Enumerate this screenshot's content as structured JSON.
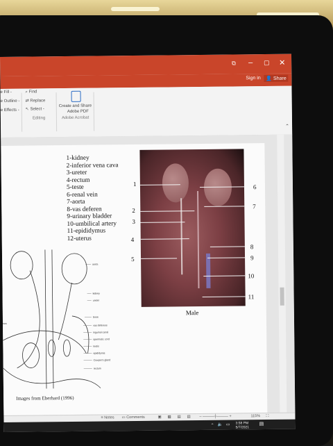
{
  "window": {
    "controls": [
      "⧉",
      "–",
      "▢",
      "✕"
    ],
    "sign_in": "Sign in",
    "share": "Share"
  },
  "ribbon": {
    "fill": "e Fill -",
    "outline": "e Outline -",
    "effects": "e Effects -",
    "find": "Find",
    "replace": "Replace",
    "select": "Select -",
    "editing_label": "Editing",
    "pdf_line1": "Create and Share",
    "pdf_line2": "Adobe PDF",
    "acrobat_label": "Adobe Acrobat"
  },
  "slide": {
    "legend": [
      "1-kidney",
      "2-inferior vena cava",
      "3-ureter",
      "4-rectum",
      "5-teste",
      "6-renal vein",
      "7-aorta",
      "8-vas deferen",
      "9-urinary bladder",
      "10-umbilical artery",
      "11-epididymus",
      "12-uterus"
    ],
    "photo_numbers_left": [
      "1",
      "2",
      "3",
      "4",
      "5"
    ],
    "photo_numbers_right": [
      "6",
      "7",
      "8",
      "9",
      "10",
      "11"
    ],
    "photo_caption": "Male",
    "drawing_labels": [
      "aorta",
      "kidney",
      "ureter",
      "bone",
      "vas deferens",
      "inguinal canal",
      "spermatic cord",
      "testis",
      "epididymis",
      "Cowper's gland",
      "rectum",
      "ries"
    ],
    "credit": "Images from Eberhard (1996)"
  },
  "status": {
    "notes": "Notes",
    "comments": "Comments",
    "zoom": "115%"
  },
  "taskbar": {
    "time": "3:58 PM",
    "date": "5/7/2021"
  }
}
